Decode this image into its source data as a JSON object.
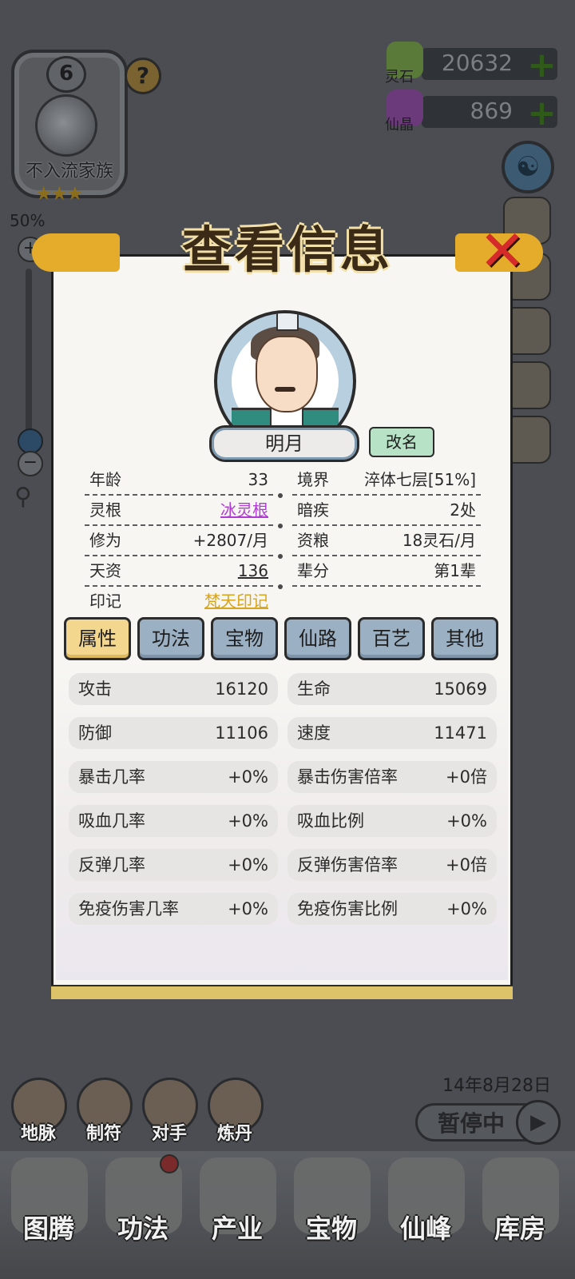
{
  "family": {
    "level": "6",
    "name": "不入流家族",
    "stars": "★★★",
    "help": "?"
  },
  "currencies": [
    {
      "label": "灵石",
      "value": "20632",
      "plus": "+",
      "color": "#5a7a3a"
    },
    {
      "label": "仙晶",
      "value": "869",
      "plus": "+",
      "color": "#6a3a7a"
    }
  ],
  "zoom": {
    "percent": "50%",
    "plus": "+",
    "minus": "−"
  },
  "panel": {
    "title": "查看信息",
    "close": "✕"
  },
  "character": {
    "name": "明月",
    "rename_label": "改名"
  },
  "info": {
    "left": [
      {
        "label": "年龄",
        "value": "33"
      },
      {
        "label": "灵根",
        "value": "冰灵根"
      },
      {
        "label": "修为",
        "value": "+2807/月"
      },
      {
        "label": "天资",
        "value": "136"
      },
      {
        "label": "印记",
        "value": "梵天印记"
      }
    ],
    "right": [
      {
        "label": "境界",
        "value": "淬体七层[51%]"
      },
      {
        "label": "暗疾",
        "value": "2处"
      },
      {
        "label": "资粮",
        "value": "18灵石/月"
      },
      {
        "label": "辈分",
        "value": "第1辈"
      }
    ]
  },
  "tabs": [
    "属性",
    "功法",
    "宝物",
    "仙路",
    "百艺",
    "其他"
  ],
  "active_tab": "属性",
  "stats": [
    {
      "label": "攻击",
      "value": "16120"
    },
    {
      "label": "生命",
      "value": "15069"
    },
    {
      "label": "防御",
      "value": "11106"
    },
    {
      "label": "速度",
      "value": "11471"
    },
    {
      "label": "暴击几率",
      "value": "+0%"
    },
    {
      "label": "暴击伤害倍率",
      "value": "+0倍"
    },
    {
      "label": "吸血几率",
      "value": "+0%"
    },
    {
      "label": "吸血比例",
      "value": "+0%"
    },
    {
      "label": "反弹几率",
      "value": "+0%"
    },
    {
      "label": "反弹伤害倍率",
      "value": "+0倍"
    },
    {
      "label": "免疫伤害几率",
      "value": "+0%"
    },
    {
      "label": "免疫伤害比例",
      "value": "+0%"
    }
  ],
  "hud": {
    "date": "14年8月28日",
    "pause_label": "暂停中",
    "mini_funcs": [
      "地脉",
      "制符",
      "对手",
      "炼丹"
    ],
    "nav": [
      "图腾",
      "功法",
      "产业",
      "宝物",
      "仙峰",
      "库房"
    ]
  },
  "colors": {
    "accent": "#f4d78f",
    "tab": "#9cb0c4",
    "link_purple": "#b13ad6",
    "link_gold": "#d8a41c",
    "close_red": "#d52b2b"
  }
}
